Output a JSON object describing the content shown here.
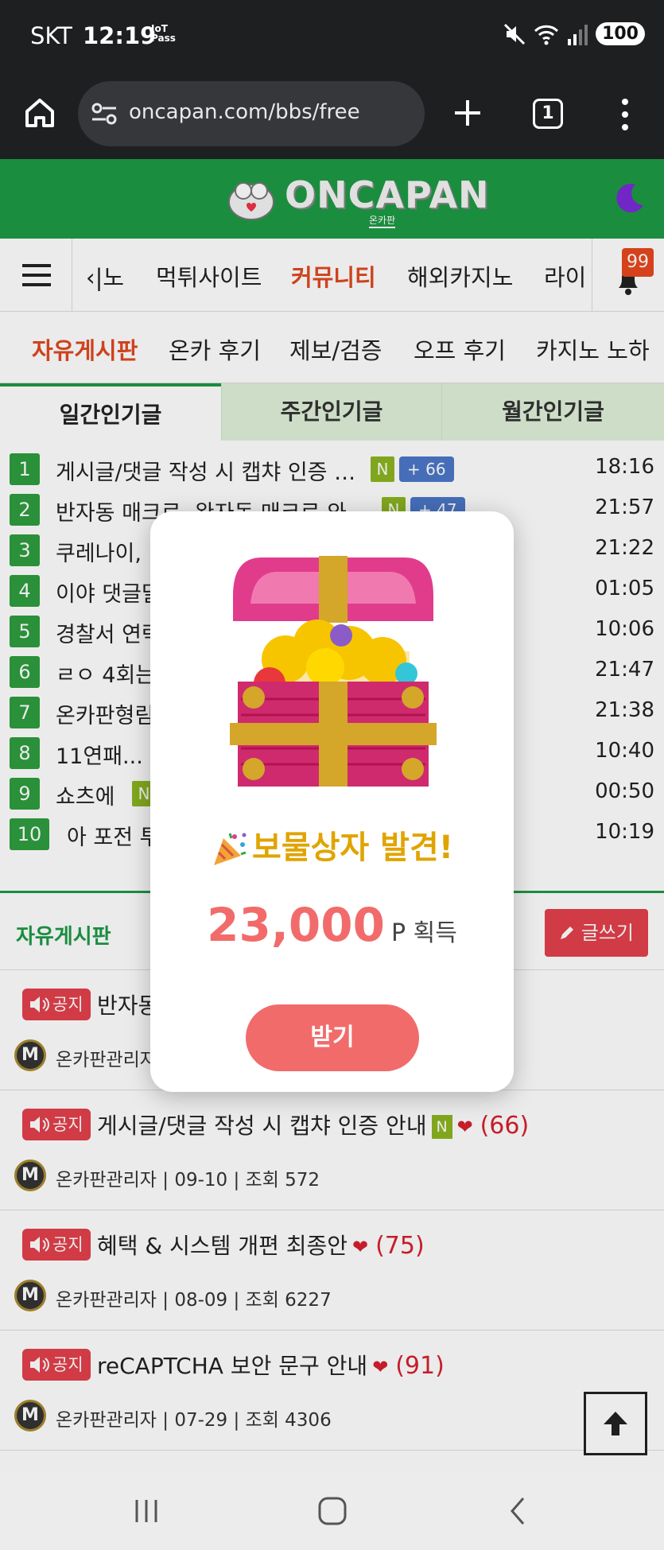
{
  "status_bar": {
    "carrier": "SKT",
    "time": "12:19",
    "iot": "IoT\nPass",
    "battery": "100"
  },
  "browser": {
    "url": "oncapan.com/bbs/free",
    "tab_count": "1"
  },
  "site": {
    "logo_text": "ONCAPAN",
    "logo_sub": "온카판"
  },
  "nav": {
    "items": [
      "‹|노",
      "먹튀사이트",
      "커뮤니티",
      "해외카지노",
      "라이"
    ],
    "active_index": 2,
    "notification_count": "99"
  },
  "subnav": {
    "items": [
      "자유게시판",
      "온카 후기",
      "제보/검증",
      "오프 후기",
      "카지노 노하"
    ],
    "active_index": 0
  },
  "popular": {
    "tabs": [
      "일간인기글",
      "주간인기글",
      "월간인기글"
    ],
    "rows": [
      {
        "rank": "1",
        "title": "게시글/댓글 작성 시 캡챠 인증 …",
        "new": "N",
        "count": "+ 66",
        "time": "18:16"
      },
      {
        "rank": "2",
        "title": "반자동 매크로, 완자동 매크로 와…",
        "new": "N",
        "count": "+ 47",
        "time": "21:57"
      },
      {
        "rank": "3",
        "title": "쿠레나이, ",
        "time": "21:22"
      },
      {
        "rank": "4",
        "title": "이야 댓글달",
        "time": "01:05"
      },
      {
        "rank": "5",
        "title": "경찰서 연락",
        "time": "10:06"
      },
      {
        "rank": "6",
        "title": "ㄹㅇ 4회는",
        "time": "21:47"
      },
      {
        "rank": "7",
        "title": "온카판형림",
        "time": "21:38"
      },
      {
        "rank": "8",
        "title": "11연패...",
        "time": "10:40"
      },
      {
        "rank": "9",
        "title": "쇼츠에",
        "new": "N",
        "time": "00:50"
      },
      {
        "rank": "10",
        "title": "아 포전 투",
        "time": "10:19"
      }
    ]
  },
  "board": {
    "title": "자유게시판",
    "write_label": "글쓰기",
    "notice_label": "공지",
    "posts": [
      {
        "title": "반자동",
        "meta": "온카판관리자"
      },
      {
        "title": "게시글/댓글 작성 시 캡챠 인증 안내",
        "new": "N",
        "comments": "(66)",
        "meta": "온카판관리자 | 09-10 | 조회 572"
      },
      {
        "title": "혜택 & 시스템 개편 최종안",
        "comments": "(75)",
        "meta": "온카판관리자 | 08-09 | 조회 6227"
      },
      {
        "title": "reCAPTCHA 보안 문구 안내",
        "comments": "(91)",
        "meta": "온카판관리자 | 07-29 | 조회 4306"
      }
    ]
  },
  "modal": {
    "title": "보물상자 발견!",
    "amount": "23,000",
    "unit": "P 획득",
    "button": "받기"
  },
  "colors": {
    "brand_green": "#1e9a45",
    "accent_red": "#e2414b",
    "modal_button": "#f26b6b",
    "title_gold": "#e0a400"
  }
}
